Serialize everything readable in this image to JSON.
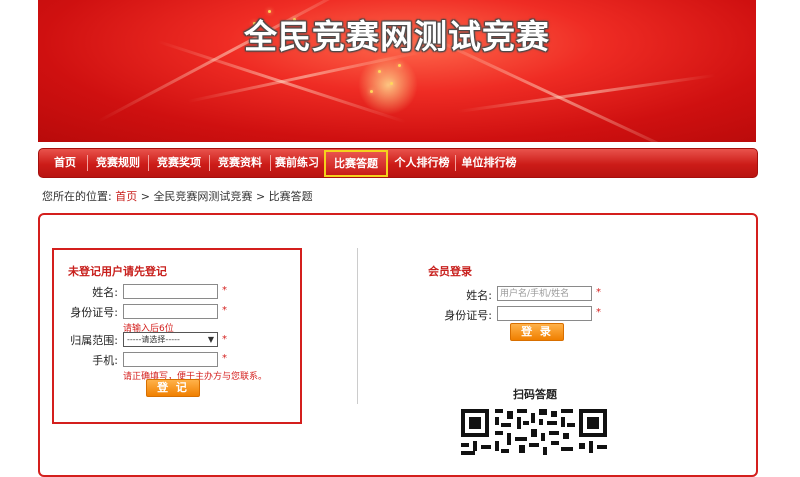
{
  "banner": {
    "title": "全民竞赛网测试竞赛"
  },
  "nav": {
    "items": [
      {
        "label": "首页",
        "name": "nav-home"
      },
      {
        "label": "竞赛规则",
        "name": "nav-rules"
      },
      {
        "label": "竞赛奖项",
        "name": "nav-awards"
      },
      {
        "label": "竞赛资料",
        "name": "nav-materials"
      },
      {
        "label": "赛前练习",
        "name": "nav-practice"
      },
      {
        "label": "比赛答题",
        "name": "nav-answer"
      },
      {
        "label": "个人排行榜",
        "name": "nav-personal-rank"
      },
      {
        "label": "单位排行榜",
        "name": "nav-unit-rank"
      }
    ],
    "active": "比赛答题"
  },
  "breadcrumb": {
    "prefix": "您所在的位置:",
    "home": "首页",
    "sep1": ">",
    "contest": "全民竞赛网测试竞赛",
    "sep2": ">",
    "current": "比赛答题"
  },
  "register": {
    "heading": "未登记用户请先登记",
    "name_label": "姓名:",
    "id_label": "身份证号:",
    "id_hint": "请输入后6位",
    "scope_label": "归属范围:",
    "scope_selected": "-----请选择-----",
    "phone_label": "手机:",
    "phone_hint": "请正确填写，便于主办方与您联系。",
    "required_mark": "*",
    "submit_label": "登 记"
  },
  "member": {
    "heading": "会员登录",
    "name_label": "姓名:",
    "name_placeholder": "用户名/手机/姓名",
    "id_label": "身份证号:",
    "required_mark": "*",
    "submit_label": "登 录"
  },
  "qr": {
    "title": "扫码答题"
  },
  "colors": {
    "brand_red": "#d41f1d",
    "nav_red": "#cc1c18",
    "active_outline": "#f4d21c",
    "button_orange": "#f07f00"
  }
}
